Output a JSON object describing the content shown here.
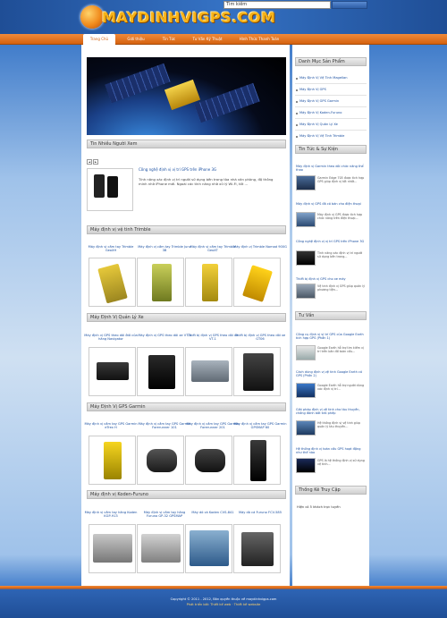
{
  "header": {
    "logo_text": "MAYDINHVIGPS.COM",
    "search_value": "Tìm kiếm"
  },
  "nav": {
    "items": [
      "Trang Chủ",
      "Giới thiệu",
      "Tin Tức",
      "Tư Vấn Kỹ Thuật",
      "Hình Thức Thanh Toán"
    ]
  },
  "main": {
    "section_news": "Tin Nhiều Người Xem",
    "pager": [
      "◄",
      "►"
    ],
    "news_title": "Công nghệ định vị vị trí GPS trên iPhone 3G",
    "news_desc": "Tính năng xác định vị trí người sử dụng bên trong tòa nhà văn phòng, độ thông minh nhờ iPhone mới. Ngoài các tính năng nhờ xử lý Wi-Fi, tốt ...",
    "sections": [
      {
        "title": "Máy định vị vệ tinh Trimble",
        "items": [
          "Máy định vị cầm tay Trimble GeoXH",
          "Máy định vị cầm tay Trimble Juno 3B",
          "Máy định vị cầm tay Trimble GeoXT",
          "Máy định vị Trimble Nomad 900G"
        ]
      },
      {
        "title": "Máy Định Vị Quản Lý Xe",
        "items": [
          "Máy định vị GPS theo dõi ôtô của hãng Navigator",
          "Máy định vị GPS theo dõi xe VT-3",
          "Thiết bị định vị GPS theo dõi xe VT-1",
          "Thiết bị định vị GPS theo dõi xe GT06"
        ]
      },
      {
        "title": "Máy Định Vị GPS Garmin",
        "items": [
          "Máy định vị cầm tay GPS Garmin eTrex H",
          "Máy định vị cầm tay GPS Garmin Forerunner 101",
          "Máy định vị cầm tay GPS Garmin Forerunner 201",
          "Máy định vị cầm tay GPS Garmin GPSMAP 60"
        ]
      },
      {
        "title": "Máy định vị Koden-Furuno",
        "items": [
          "Máy định vị cầm tay hãng Koden KGP-913",
          "Máy định vị cầm tay hãng Furuno GP-32 GPSMAP",
          "Máy dò cá Koden CVS-841",
          "Máy dò cá Furuno FCV-585"
        ]
      }
    ]
  },
  "sidebar": {
    "products_title": "Danh Mục Sản Phẩm",
    "products": [
      "Máy Định Vị Vệ Tinh Magellan",
      "Máy Định Vị GPS",
      "Máy Định Vị GPS Garmin",
      "Máy Định Vị Koden-Furuno",
      "Máy Định Vị Quản Lý Xe",
      "Máy Định Vị Vệ Tinh Trimble"
    ],
    "news_title": "Tin Tức & Sự Kiện",
    "news": [
      {
        "title": "Máy định vị Garmin theo dõi chức năng thể thao",
        "desc": "Garmin Edge 705 được tích hợp GPS giúp định vị tốt nhất..."
      },
      {
        "title": "Máy định vị GPS đã có bán cho điện thoại",
        "desc": "Máy định vị GPS được tích hợp chức năng trên điện thoại..."
      },
      {
        "title": "Công nghệ định vị vị trí GPS trên iPhone 3G",
        "desc": "Tính năng xác định vị trí người sử dụng bên trong..."
      },
      {
        "title": "Thiết bị định vị GPS cho xe máy",
        "desc": "Vệ tinh định vị GPS giúp quản lý phương tiện..."
      }
    ],
    "advice_title": "Tư Vấn",
    "advice": [
      {
        "title": "Công cụ định vị vị trí GPS của Google Earth tích hợp GPS (Phần 1)",
        "desc": "Google Earth hỗ trợ tìm kiếm vị trí trên bản đồ toàn cầu..."
      },
      {
        "title": "Cách dùng định vị vệ tinh Google Earth có GPS (Phần 2)",
        "desc": "Google Earth hỗ trợ người dùng xác định vị trí..."
      },
      {
        "title": "Giải pháp định vị vệ tinh cho tàu thuyền, chống đánh bắt trái phép",
        "desc": "Hệ thống định vị vệ tinh giúp quản lý tàu thuyền..."
      },
      {
        "title": "Hệ thống định vị toàn cầu GPS hoạt động như thế nào",
        "desc": "GPS là hệ thống định vị sử dụng vệ tinh..."
      }
    ],
    "stats_title": "Thống Kê Truy Cập",
    "stats_text": "Hiện có 5 khách trực tuyến"
  },
  "footer": {
    "line1": "Copyright © 2011 - 2012, Bản quyền thuộc về maydinhvigps.com",
    "line2": "Phát triển bởi: Thiết kế web · Thiết kế website"
  },
  "colors": {
    "header_blue": "#2a5ca8",
    "nav_orange": "#e0701f",
    "link_blue": "#1a4fa0",
    "logo_gold": "#f7b318"
  }
}
